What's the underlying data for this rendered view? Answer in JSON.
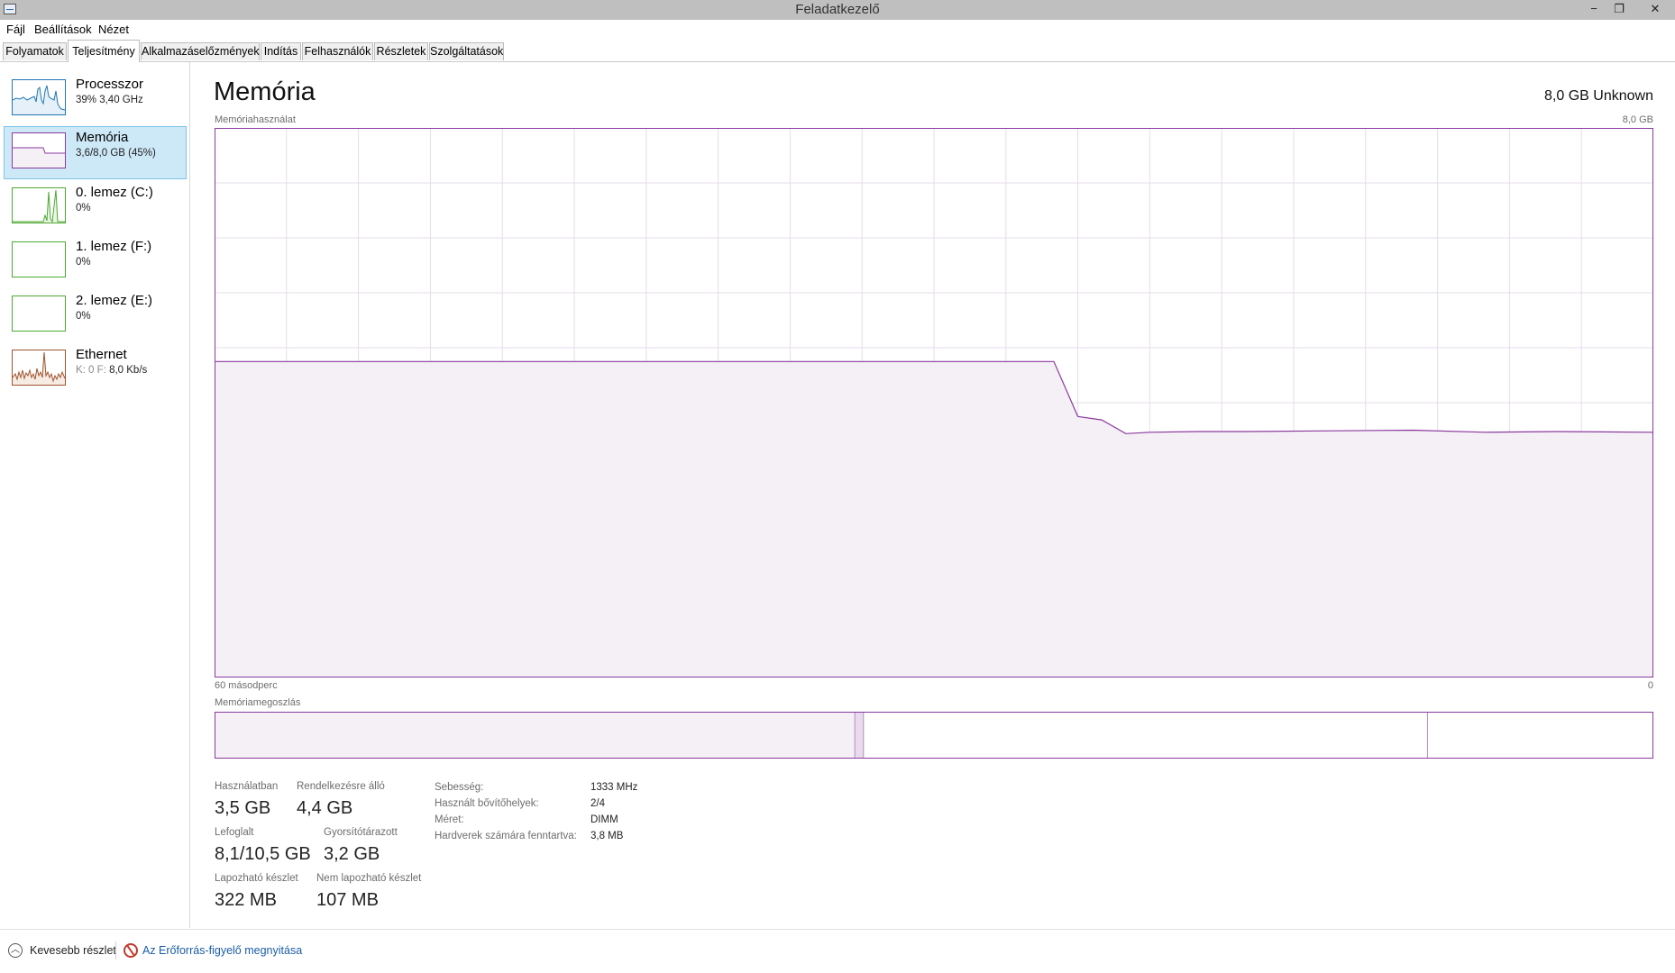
{
  "window": {
    "title": "Feladatkezelő",
    "controls": {
      "minimize": "−",
      "restore": "❐",
      "close": "✕"
    }
  },
  "menu": [
    "Fájl",
    "Beállítások",
    "Nézet"
  ],
  "tabs": [
    "Folyamatok",
    "Teljesítmény",
    "Alkalmazáselőzmények",
    "Indítás",
    "Felhasználók",
    "Részletek",
    "Szolgáltatások"
  ],
  "active_tab": "Teljesítmény",
  "sidebar": {
    "items": [
      {
        "name": "Processzor",
        "value": "39% 3,40 GHz",
        "color": "#1f77b4"
      },
      {
        "name": "Memória",
        "value": "3,6/8,0 GB (45%)",
        "color": "#8b3a9e"
      },
      {
        "name": "0. lemez (C:)",
        "value": "0%",
        "color": "#4da832"
      },
      {
        "name": "1. lemez (F:)",
        "value": "0%",
        "color": "#4da832"
      },
      {
        "name": "2. lemez (E:)",
        "value": "0%",
        "color": "#4da832"
      },
      {
        "name": "Ethernet",
        "value_prefix": "K: 0 F:",
        "value": "8,0 Kb/s",
        "color": "#a0522d"
      }
    ]
  },
  "main": {
    "title": "Memória",
    "subtitle": "8,0 GB Unknown",
    "usage_label": "Memóriahasználat",
    "usage_max": "8,0 GB",
    "time_left": "60 másodperc",
    "time_right": "0",
    "composition_label": "Memóriamegoszlás"
  },
  "chart_data": {
    "type": "area",
    "title": "Memóriahasználat",
    "xlabel": "",
    "ylabel": "",
    "x_range": [
      60,
      0
    ],
    "ylim": [
      0,
      8.0
    ],
    "grid": true,
    "series": [
      {
        "x": [
          60,
          25,
          24,
          23,
          22,
          21,
          19,
          17,
          14,
          10,
          7,
          4,
          0
        ],
        "values": [
          4.6,
          4.6,
          3.8,
          3.75,
          3.55,
          3.57,
          3.58,
          3.58,
          3.59,
          3.6,
          3.57,
          3.58,
          3.57
        ]
      }
    ],
    "colors": {
      "line": "#8b3a9e",
      "fill": "#f4f0f5",
      "grid": "#e6dce8"
    }
  },
  "composition": {
    "segments": [
      {
        "kind": "in_use",
        "fraction": 0.445
      },
      {
        "kind": "modified",
        "fraction": 0.006
      },
      {
        "kind": "standby",
        "fraction": 0.392
      },
      {
        "kind": "free",
        "fraction": 0.157
      }
    ]
  },
  "stats": {
    "in_use_label": "Használatban",
    "in_use": "3,5 GB",
    "available_label": "Rendelkezésre álló",
    "available": "4,4 GB",
    "committed_label": "Lefoglalt",
    "committed": "8,1/10,5 GB",
    "cached_label": "Gyorsítótárazott",
    "cached": "3,2 GB",
    "paged_label": "Lapozható készlet",
    "paged": "322 MB",
    "nonpaged_label": "Nem lapozható készlet",
    "nonpaged": "107 MB"
  },
  "hardware": {
    "speed_label": "Sebesség:",
    "speed": "1333 MHz",
    "slots_label": "Használt bővítőhelyek:",
    "slots": "2/4",
    "form_label": "Méret:",
    "form": "DIMM",
    "reserved_label": "Hardverek számára fenntartva:",
    "reserved": "3,8 MB"
  },
  "footer": {
    "fewer_details": "Kevesebb részlet",
    "resmon": "Az Erőforrás-figyelő megnyitása"
  }
}
